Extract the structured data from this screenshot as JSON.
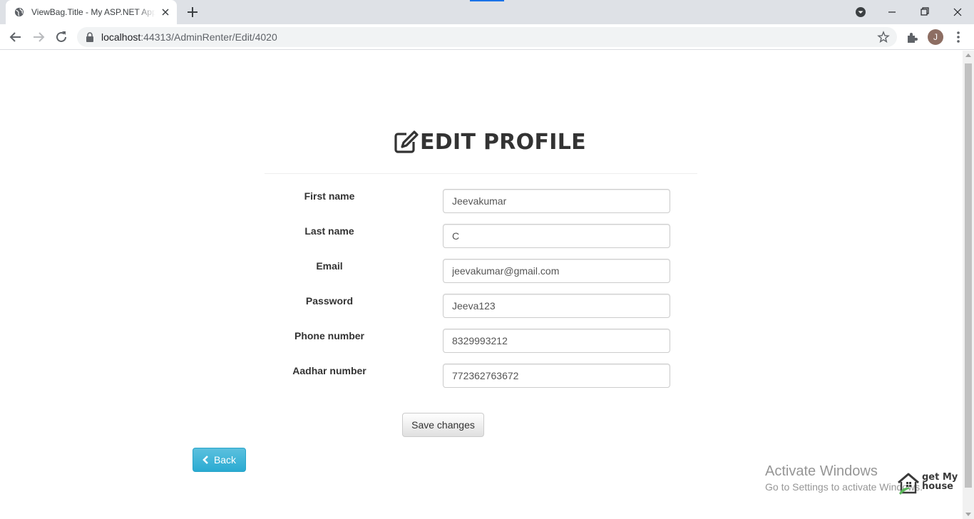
{
  "browser": {
    "tab_title": "ViewBag.Title - My ASP.NET Application",
    "url_host": "localhost",
    "url_rest": ":44313/AdminRenter/Edit/4020",
    "avatar_initial": "J"
  },
  "page": {
    "heading": "EDIT PROFILE",
    "heading_icon": "edit-icon",
    "fields": [
      {
        "label": "First name",
        "value": "Jeevakumar"
      },
      {
        "label": "Last name",
        "value": "C"
      },
      {
        "label": "Email",
        "value": "jeevakumar@gmail.com"
      },
      {
        "label": "Password",
        "value": "Jeeva123"
      },
      {
        "label": "Phone number",
        "value": "8329993212"
      },
      {
        "label": "Aadhar number",
        "value": "772362763672"
      }
    ],
    "save_label": "Save changes",
    "back_label": "Back"
  },
  "watermark": {
    "title": "Activate Windows",
    "subtitle": "Go to Settings to activate Windows."
  },
  "logo": {
    "line1": "get My",
    "line2": "house"
  },
  "colors": {
    "back_button": "#31b0d5",
    "accent": "#1a73e8"
  }
}
